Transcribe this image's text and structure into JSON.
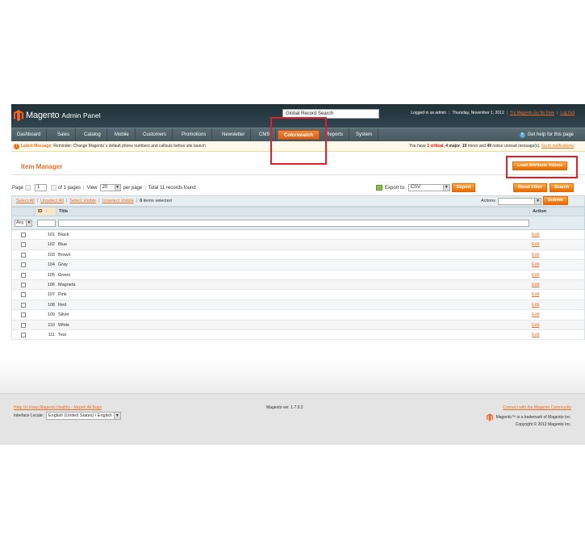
{
  "header": {
    "brand": "Magento",
    "subtitle": "Admin Panel",
    "global_search": "Global Record Search",
    "logged_in": "Logged in as admin",
    "date": "Thursday, November 1, 2012",
    "try_link": "Try Magento Go for Free",
    "logout": "Log Out"
  },
  "nav": {
    "items": [
      "Dashboard",
      "Sales",
      "Catalog",
      "Mobile",
      "Customers",
      "Promotions",
      "Newsletter",
      "CMS",
      "Colorswatch",
      "Reports",
      "System"
    ],
    "active": "Colorswatch",
    "help": "Get help for this page"
  },
  "message": {
    "label": "Latest Message:",
    "text": "Reminder: Change Magento`s default phone numbers and callouts before site launch",
    "summary_prefix": "You have",
    "critical": "1 critical",
    "major": "4 major",
    "minor": "19",
    "minor_label": "minor and",
    "notice": "49",
    "notice_label": "notice unread message(s).",
    "go_link": "Go to notifications"
  },
  "manager": {
    "title": "Item Manager",
    "load_button": "Load Attribute Values"
  },
  "pager": {
    "page_label": "Page",
    "page_value": "1",
    "of_pages": "of 1 pages",
    "view_label": "View",
    "view_value": "20",
    "per_page": "per page",
    "total": "Total 11 records found"
  },
  "export": {
    "label": "Export to:",
    "value": "CSV",
    "button": "Export",
    "reset": "Reset Filter",
    "search": "Search"
  },
  "massaction": {
    "select_all": "Select All",
    "unselect_all": "Unselect All",
    "select_visible": "Select Visible",
    "unselect_visible": "Unselect Visible",
    "selected_count": "0",
    "selected_label": "items selected",
    "actions_label": "Actions",
    "submit": "Submit"
  },
  "grid": {
    "headers": {
      "id": "ID",
      "title": "Title",
      "action": "Action"
    },
    "filter_any": "Any",
    "rows": [
      {
        "id": "101",
        "title": "Black",
        "action": "Edit"
      },
      {
        "id": "102",
        "title": "Blue",
        "action": "Edit"
      },
      {
        "id": "103",
        "title": "Brown",
        "action": "Edit"
      },
      {
        "id": "104",
        "title": "Gray",
        "action": "Edit"
      },
      {
        "id": "105",
        "title": "Green",
        "action": "Edit"
      },
      {
        "id": "106",
        "title": "Magneta",
        "action": "Edit"
      },
      {
        "id": "107",
        "title": "Pink",
        "action": "Edit"
      },
      {
        "id": "108",
        "title": "Red",
        "action": "Edit"
      },
      {
        "id": "109",
        "title": "Silver",
        "action": "Edit"
      },
      {
        "id": "110",
        "title": "White",
        "action": "Edit"
      },
      {
        "id": "111",
        "title": "Test",
        "action": "Edit"
      }
    ]
  },
  "footer": {
    "bugs_link": "Help Us Keep Magento Healthy - Report All Bugs",
    "locale_label": "Interface Locale:",
    "locale_value": "English (United States) / English",
    "version": "Magento ver. 1.7.0.2",
    "connect_link": "Connect with the Magento Community",
    "trademark": "Magento™ is a trademark of Magento Inc.",
    "copyright": "Copyright © 2012 Magento Inc."
  },
  "colors": {
    "accent": "#eb6e27",
    "header_bg": "#203039",
    "nav_bg": "#4b5f66",
    "annotation_red": "#e0202a"
  }
}
